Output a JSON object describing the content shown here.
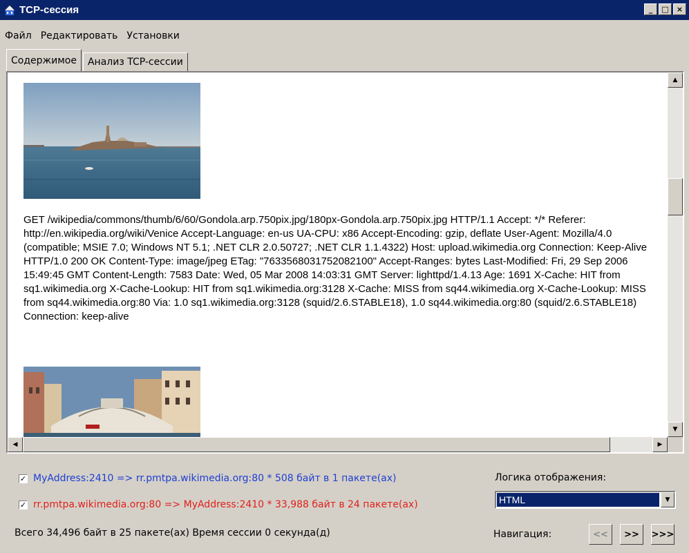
{
  "window": {
    "title": "TCP-сессия",
    "min_glyph": "_",
    "max_glyph": "□",
    "close_glyph": "×"
  },
  "menu": [
    "Файл",
    "Редактировать",
    "Установки"
  ],
  "tabs": [
    {
      "label": "Содержимое",
      "active": true
    },
    {
      "label": "Анализ TCP-сессии",
      "active": false
    }
  ],
  "content": {
    "http_text": "GET /wikipedia/commons/thumb/6/60/Gondola.arp.750pix.jpg/180px-Gondola.arp.750pix.jpg HTTP/1.1 Accept: */* Referer: http://en.wikipedia.org/wiki/Venice Accept-Language: en-us UA-CPU: x86 Accept-Encoding: gzip, deflate User-Agent: Mozilla/4.0 (compatible; MSIE 7.0; Windows NT 5.1; .NET CLR 2.0.50727; .NET CLR 1.1.4322) Host: upload.wikimedia.org Connection: Keep-Alive HTTP/1.0 200 OK Content-Type: image/jpeg ETag: \"7633568031752082100\" Accept-Ranges: bytes Last-Modified: Fri, 29 Sep 2006 15:49:45 GMT Content-Length: 7583 Date: Wed, 05 Mar 2008 14:03:31 GMT Server: lighttpd/1.4.13 Age: 1691 X-Cache: HIT from sq1.wikimedia.org X-Cache-Lookup: HIT from sq1.wikimedia.org:3128 X-Cache: MISS from sq44.wikimedia.org X-Cache-Lookup: MISS from sq44.wikimedia.org:80 Via: 1.0 sq1.wikimedia.org:3128 (squid/2.6.STABLE18), 1.0 sq44.wikimedia.org:80 (squid/2.6.STABLE18) Connection: keep-alive"
  },
  "streams": [
    {
      "checked": true,
      "text": "MyAddress:2410 => rr.pmtpa.wikimedia.org:80 * 508  байт в  1 пакете(ах)",
      "color": "#1f3fd0"
    },
    {
      "checked": true,
      "text": "rr.pmtpa.wikimedia.org:80 => MyAddress:2410 * 33,988 байт в  24 пакете(ах)",
      "color": "#e0201a"
    }
  ],
  "summary": "Всего 34,496 байт в  25 пакете(ах)   Время сессии 0 секунда(д)",
  "display_logic": {
    "label": "Логика отображения:",
    "value": "HTML"
  },
  "navigation": {
    "label": "Навигация:",
    "buttons": [
      "<<",
      ">>",
      ">>>"
    ]
  },
  "colors": {
    "title_bar": "#0a246a",
    "selection": "#0a246a",
    "face": "#d4d0c8"
  }
}
